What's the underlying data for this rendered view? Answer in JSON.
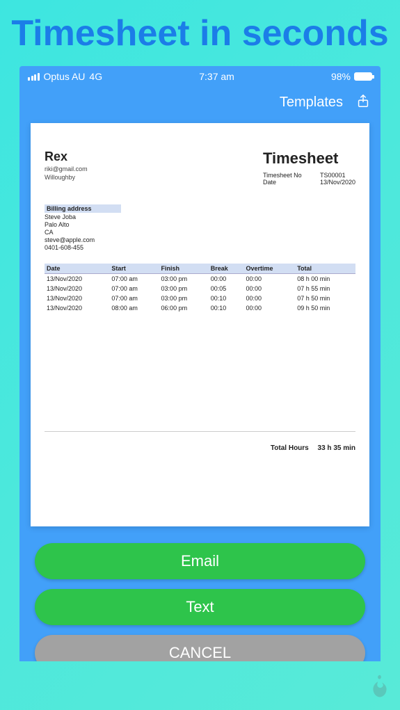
{
  "promo_title": "Timesheet in seconds",
  "status": {
    "carrier": "Optus AU",
    "network": "4G",
    "time": "7:37 am",
    "battery_pct": "98%"
  },
  "nav": {
    "templates_label": "Templates"
  },
  "sender": {
    "name": "Rex",
    "email": "riki@gmail.com",
    "city": "Willoughby"
  },
  "doc_title": "Timesheet",
  "meta": {
    "no_label": "Timesheet No",
    "no_value": "TS00001",
    "date_label": "Date",
    "date_value": "13/Nov/2020"
  },
  "billing": {
    "header": "Billing address",
    "name": "Steve Joba",
    "city": "Palo Alto",
    "state": "CA",
    "email": "steve@apple.com",
    "phone": "0401-608-455"
  },
  "columns": {
    "date": "Date",
    "start": "Start",
    "finish": "Finish",
    "break": "Break",
    "overtime": "Overtime",
    "total": "Total"
  },
  "rows": [
    {
      "date": "13/Nov/2020",
      "start": "07:00 am",
      "finish": "03:00 pm",
      "break": "00:00",
      "overtime": "00:00",
      "total": "08 h 00 min"
    },
    {
      "date": "13/Nov/2020",
      "start": "07:00 am",
      "finish": "03:00 pm",
      "break": "00:05",
      "overtime": "00:00",
      "total": "07 h 55 min"
    },
    {
      "date": "13/Nov/2020",
      "start": "07:00 am",
      "finish": "03:00 pm",
      "break": "00:10",
      "overtime": "00:00",
      "total": "07 h 50 min"
    },
    {
      "date": "13/Nov/2020",
      "start": "08:00 am",
      "finish": "06:00 pm",
      "break": "00:10",
      "overtime": "00:00",
      "total": "09 h 50 min"
    }
  ],
  "totals": {
    "label": "Total Hours",
    "value": "33 h 35 min"
  },
  "actions": {
    "email": "Email",
    "text": "Text",
    "cancel": "CANCEL"
  }
}
